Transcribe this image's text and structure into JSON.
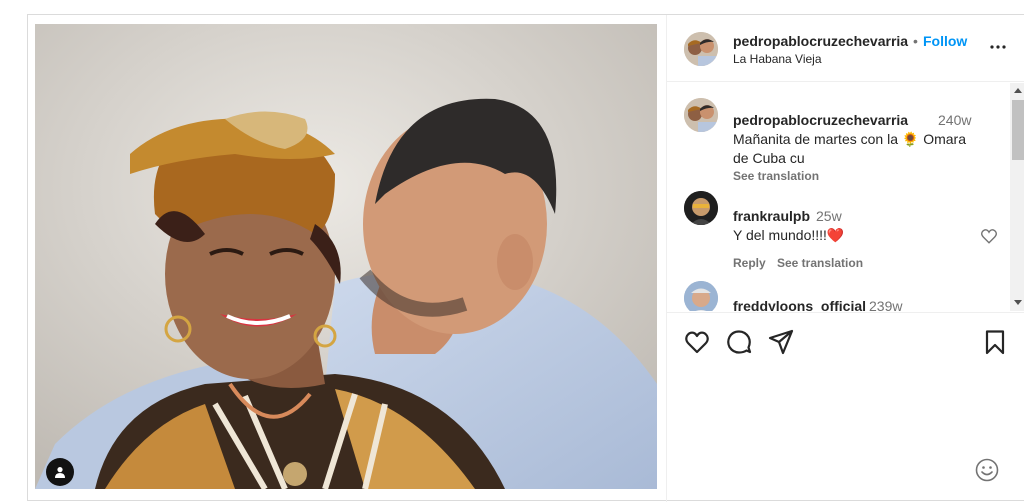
{
  "post": {
    "username": "pedropablocruzechevarria",
    "separator": "•",
    "follow_label": "Follow",
    "location": "La Habana Vieja",
    "more_icon": "more-options-icon"
  },
  "comments": [
    {
      "username": "pedropablocruzechevarria",
      "time": "240w",
      "text_line1": "Mañanita de martes con la 🌻 Omara",
      "text_line2": "de Cuba cu",
      "see_translation": "See translation"
    },
    {
      "username": "frankraulpb",
      "time": "25w",
      "text": "Y del mundo!!!!❤️",
      "reply": "Reply",
      "see_translation": "See translation"
    },
    {
      "username": "freddyloons_official",
      "time": "239w",
      "text": "👏👏👏"
    }
  ],
  "actions": {
    "like_icon": "heart-icon",
    "comment_icon": "comment-icon",
    "share_icon": "share-icon",
    "save_icon": "bookmark-icon",
    "emoji_icon": "emoji-icon"
  },
  "colors": {
    "follow": "#0095f6",
    "muted": "#737373",
    "text": "#262626",
    "heart_red": "#ff3040"
  }
}
